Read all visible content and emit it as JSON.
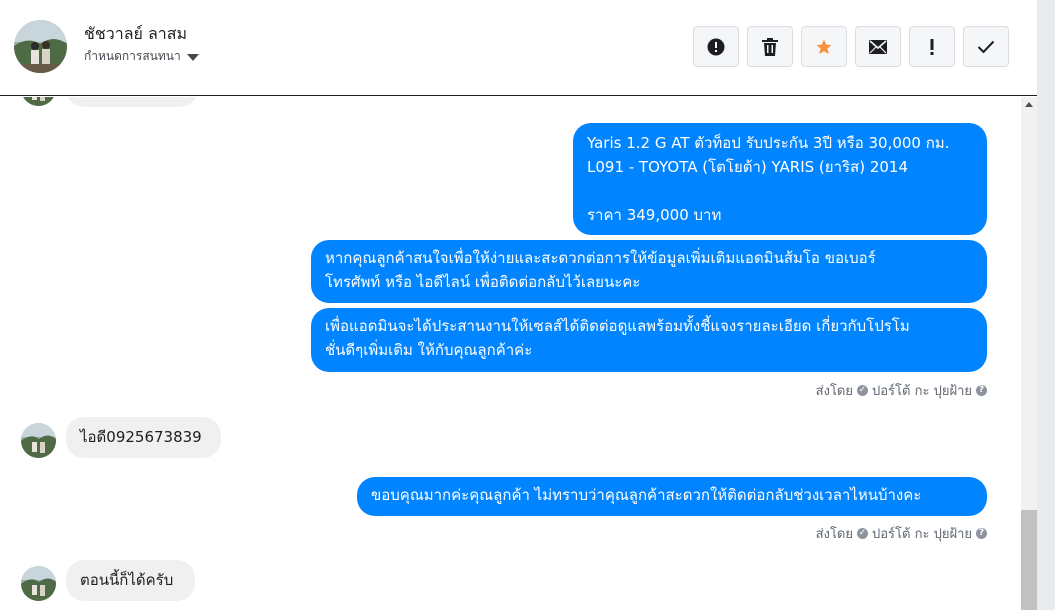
{
  "header": {
    "contact_name": "ชัชวาลย์ ลาสม",
    "assign_label": "กำหนดการสนทนา",
    "actions": [
      {
        "name": "spam-button",
        "icon": "alert-circle-icon"
      },
      {
        "name": "delete-button",
        "icon": "trash-icon"
      },
      {
        "name": "star-button",
        "icon": "star-icon",
        "color": "#f7923b"
      },
      {
        "name": "mark-unread-button",
        "icon": "envelope-icon"
      },
      {
        "name": "follow-up-button",
        "icon": "exclamation-icon"
      },
      {
        "name": "mark-done-button",
        "icon": "checkmark-icon"
      }
    ]
  },
  "messages": {
    "m1": "Yaris 1.2 G AT ตัวท็อป รับประกัน 3ปี หรือ 30,000 กม.\nL091 - TOYOTA (โตโยต้า) YARIS (ยาริส) 2014\n\nราคา 349,000 บาท",
    "m2": "หากคุณลูกค้าสนใจเพื่อให้ง่ายและสะดวกต่อการให้ข้อมูลเพิ่มเติมแอดมินส้มโอ ขอเบอร์\nโทรศัพท์ หรือ ไอดีไลน์ เพื่อติดต่อกลับไว้เลยนะคะ",
    "m3": "เพื่อแอดมินจะได้ประสานงานให้เซลส์ได้ติดต่อดูแลพร้อมทั้งชี้แจงรายละเอียด เกี่ยวกับโปรโม\nชั่นดีๆเพิ่มเติม ให้กับคุณลูกค้าค่ะ",
    "sent_by_1": "ส่งโดย",
    "sender_1": "ปอร์โต้ กะ ปุยฝ้าย",
    "m4": "ไอดี0925673839",
    "m5": "ขอบคุณมากค่ะคุณลูกค้า ไม่ทราบว่าคุณลูกค้าสะดวกให้ติดต่อกลับช่วงเวลาไหนบ้างคะ",
    "sent_by_2": "ส่งโดย",
    "sender_2": "ปอร์โต้ กะ ปุยฝ้าย",
    "m6": "ตอนนี้ก็ได้ครับ"
  },
  "colors": {
    "outgoing_bubble": "#0084ff",
    "incoming_bubble": "#f1f0f0",
    "star": "#f7923b"
  }
}
